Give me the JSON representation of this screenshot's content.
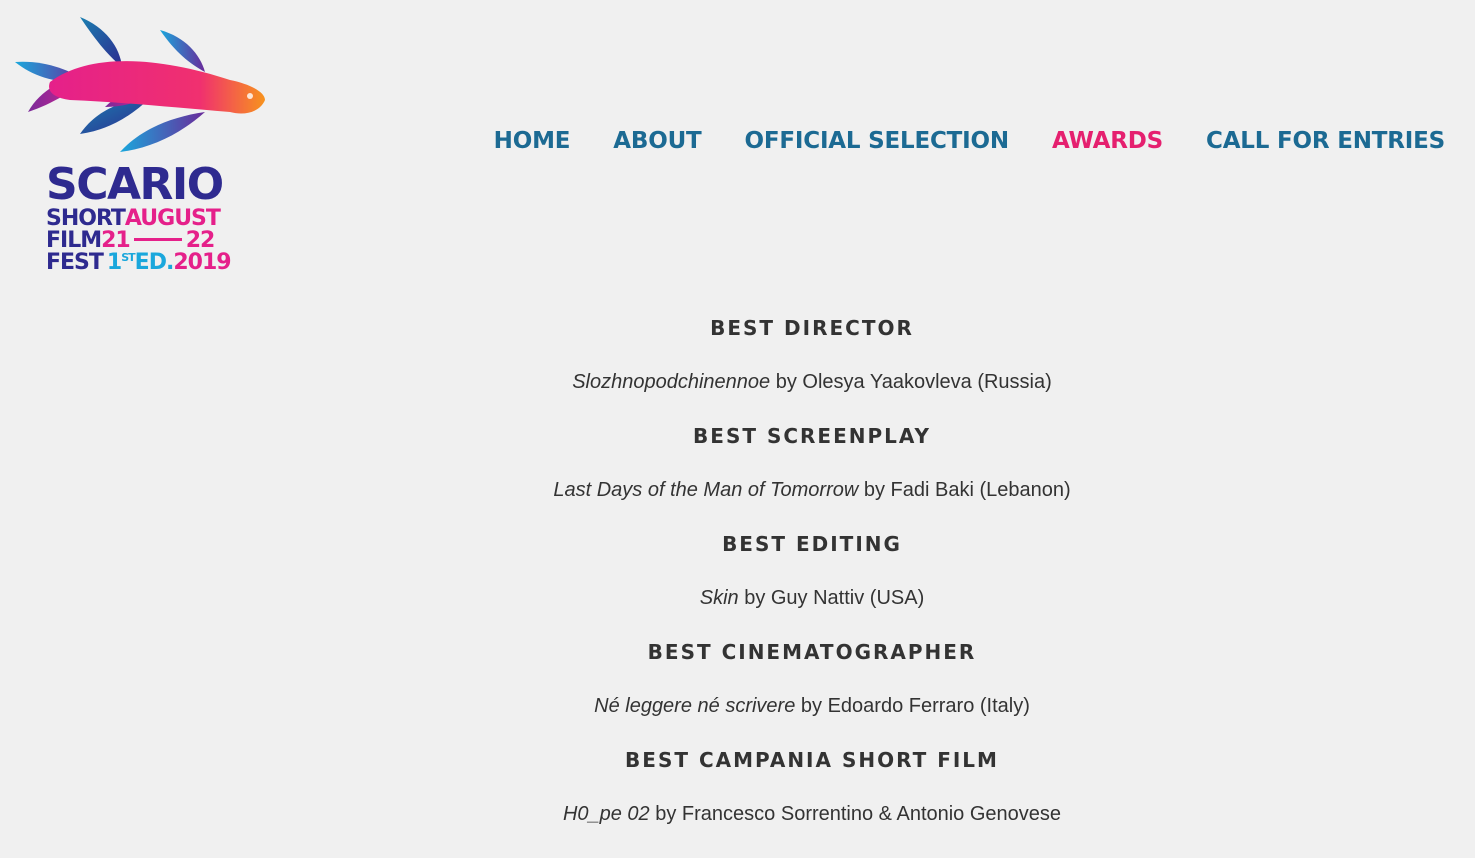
{
  "logo": {
    "title": "SCARIO",
    "line1_left": "SHORT",
    "line1_right": "AUGUST",
    "line2_left": "FILM",
    "line2_day_start": "21",
    "line2_day_end": "22",
    "line3_left": "FEST",
    "line3_edition_num": "1",
    "line3_edition_sup": "ST",
    "line3_edition_suffix": "ED.",
    "line3_year": "2019",
    "colors": {
      "primary": "#2e2a8f",
      "accent": "#e5208a",
      "secondary": "#1aa7dc",
      "orange": "#f7931e"
    }
  },
  "nav": {
    "items": [
      {
        "label": "HOME",
        "active": false
      },
      {
        "label": "ABOUT",
        "active": false
      },
      {
        "label": "OFFICIAL SELECTION",
        "active": false
      },
      {
        "label": "AWARDS",
        "active": true
      },
      {
        "label": "CALL FOR ENTRIES",
        "active": false
      }
    ],
    "color": "#1c6a93",
    "active_color": "#e5206f"
  },
  "awards": [
    {
      "category": "BEST DIRECTOR",
      "film": "Slozhnopodchinennoe",
      "credit": " by Olesya Yaakovleva (Russia)"
    },
    {
      "category": "BEST SCREENPLAY",
      "film": "Last Days of the Man of Tomorrow",
      "credit": " by Fadi Baki (Lebanon)"
    },
    {
      "category": "BEST EDITING",
      "film": "Skin",
      "credit": " by Guy Nattiv (USA)"
    },
    {
      "category": "BEST CINEMATOGRAPHER",
      "film": "Né leggere né scrivere",
      "credit": " by Edoardo Ferraro (Italy)"
    },
    {
      "category": "BEST CAMPANIA SHORT FILM",
      "film": "H0_pe 02",
      "credit": " by Francesco Sorrentino & Antonio Genovese"
    }
  ]
}
